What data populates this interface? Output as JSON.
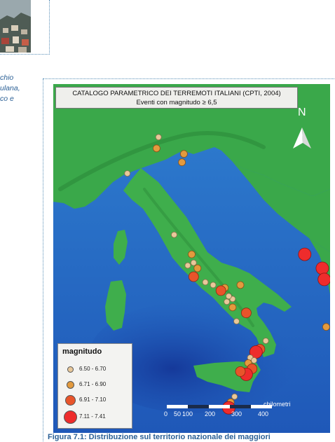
{
  "side_text": [
    "chio",
    "ulana,",
    "",
    "co e"
  ],
  "map": {
    "title": "CATALOGO PARAMETRICO DEI TERREMOTI ITALIANI (CPTI, 2004)",
    "subtitle": "Eventi con magnitudo ≥ 6,5",
    "north_label": "N",
    "legend_title": "magnitudo",
    "legend": [
      {
        "label": "6.50 - 6.70",
        "color": "#e8c89a"
      },
      {
        "label": "6.71 - 6.90",
        "color": "#e39a3e"
      },
      {
        "label": "6.91 - 7.10",
        "color": "#e8542a"
      },
      {
        "label": "7.11 - 7.41",
        "color": "#ee2c2c"
      }
    ],
    "scale": {
      "ticks": [
        "0",
        "50",
        "100",
        "200",
        "300",
        "400"
      ],
      "unit": "chilometri"
    },
    "events": [
      {
        "lon": 11.4,
        "lat": 46.6,
        "class": 0
      },
      {
        "lon": 11.3,
        "lat": 46.2,
        "class": 1
      },
      {
        "lon": 9.8,
        "lat": 45.3,
        "class": 0
      },
      {
        "lon": 12.7,
        "lat": 46.0,
        "class": 1
      },
      {
        "lon": 12.6,
        "lat": 45.7,
        "class": 1
      },
      {
        "lon": 12.2,
        "lat": 43.1,
        "class": 0
      },
      {
        "lon": 13.1,
        "lat": 42.4,
        "class": 1
      },
      {
        "lon": 13.2,
        "lat": 42.1,
        "class": 0
      },
      {
        "lon": 12.9,
        "lat": 42.0,
        "class": 0
      },
      {
        "lon": 13.4,
        "lat": 41.9,
        "class": 1
      },
      {
        "lon": 13.2,
        "lat": 41.6,
        "class": 2
      },
      {
        "lon": 13.8,
        "lat": 41.4,
        "class": 0
      },
      {
        "lon": 14.2,
        "lat": 41.3,
        "class": 0
      },
      {
        "lon": 14.8,
        "lat": 41.2,
        "class": 1
      },
      {
        "lon": 14.6,
        "lat": 41.1,
        "class": 2
      },
      {
        "lon": 15.2,
        "lat": 40.8,
        "class": 0
      },
      {
        "lon": 15.0,
        "lat": 40.9,
        "class": 0
      },
      {
        "lon": 14.9,
        "lat": 40.7,
        "class": 0
      },
      {
        "lon": 15.6,
        "lat": 41.3,
        "class": 1
      },
      {
        "lon": 15.2,
        "lat": 40.5,
        "class": 1
      },
      {
        "lon": 15.4,
        "lat": 40.0,
        "class": 0
      },
      {
        "lon": 15.9,
        "lat": 40.3,
        "class": 2
      },
      {
        "lon": 16.9,
        "lat": 39.3,
        "class": 0
      },
      {
        "lon": 16.6,
        "lat": 39.0,
        "class": 2
      },
      {
        "lon": 16.4,
        "lat": 38.9,
        "class": 3
      },
      {
        "lon": 16.1,
        "lat": 38.7,
        "class": 0
      },
      {
        "lon": 16.3,
        "lat": 38.6,
        "class": 0
      },
      {
        "lon": 16.0,
        "lat": 38.5,
        "class": 1
      },
      {
        "lon": 16.2,
        "lat": 38.3,
        "class": 2
      },
      {
        "lon": 15.9,
        "lat": 38.1,
        "class": 3
      },
      {
        "lon": 15.6,
        "lat": 38.2,
        "class": 2
      },
      {
        "lon": 15.3,
        "lat": 37.3,
        "class": 0
      },
      {
        "lon": 15.1,
        "lat": 37.1,
        "class": 1
      },
      {
        "lon": 15.0,
        "lat": 36.9,
        "class": 3
      },
      {
        "lon": 18.9,
        "lat": 42.4,
        "class": 3
      },
      {
        "lon": 19.8,
        "lat": 41.9,
        "class": 3
      },
      {
        "lon": 19.9,
        "lat": 41.5,
        "class": 3
      },
      {
        "lon": 20.0,
        "lat": 39.8,
        "class": 1
      }
    ]
  },
  "caption": "Figura 7.1: Distribuzione sul territorio nazionale dei maggiori"
}
